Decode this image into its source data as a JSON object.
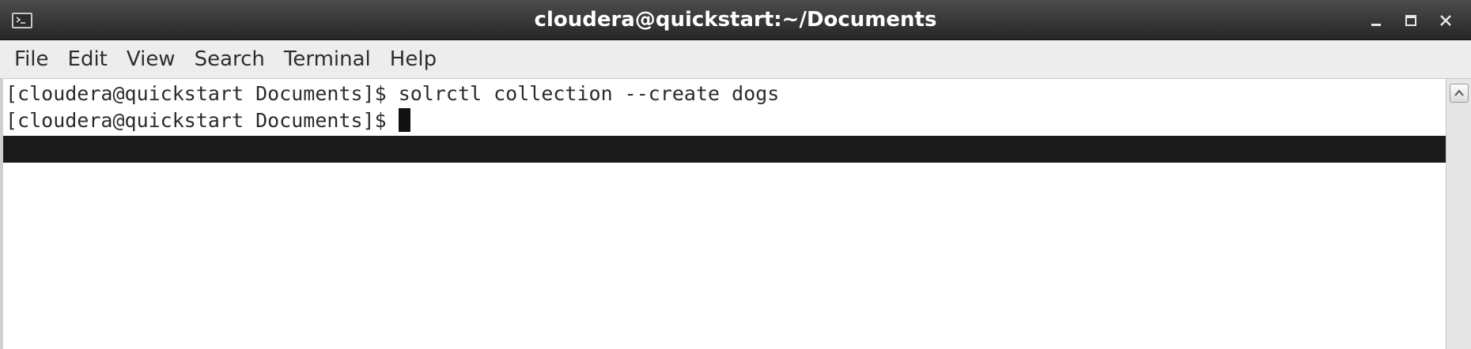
{
  "window": {
    "title": "cloudera@quickstart:~/Documents",
    "controls": [
      "minimize",
      "maximize",
      "close"
    ]
  },
  "menu": {
    "items": [
      "File",
      "Edit",
      "View",
      "Search",
      "Terminal",
      "Help"
    ]
  },
  "terminal": {
    "lines": [
      {
        "prompt": "[cloudera@quickstart Documents]$ ",
        "command": "solrctl collection --create dogs"
      },
      {
        "prompt": "[cloudera@quickstart Documents]$ ",
        "command": ""
      }
    ]
  },
  "icons": {
    "app": "terminal-icon",
    "minimize": "minimize-icon",
    "maximize": "maximize-icon",
    "close": "close-icon",
    "scroll_up": "arrow-up-icon"
  },
  "colors": {
    "titlebar": "#333333",
    "menubar": "#ededed",
    "terminal_bg": "#ffffff",
    "terminal_fg": "#2b2b2b",
    "highlight": "#1a1a1a"
  }
}
